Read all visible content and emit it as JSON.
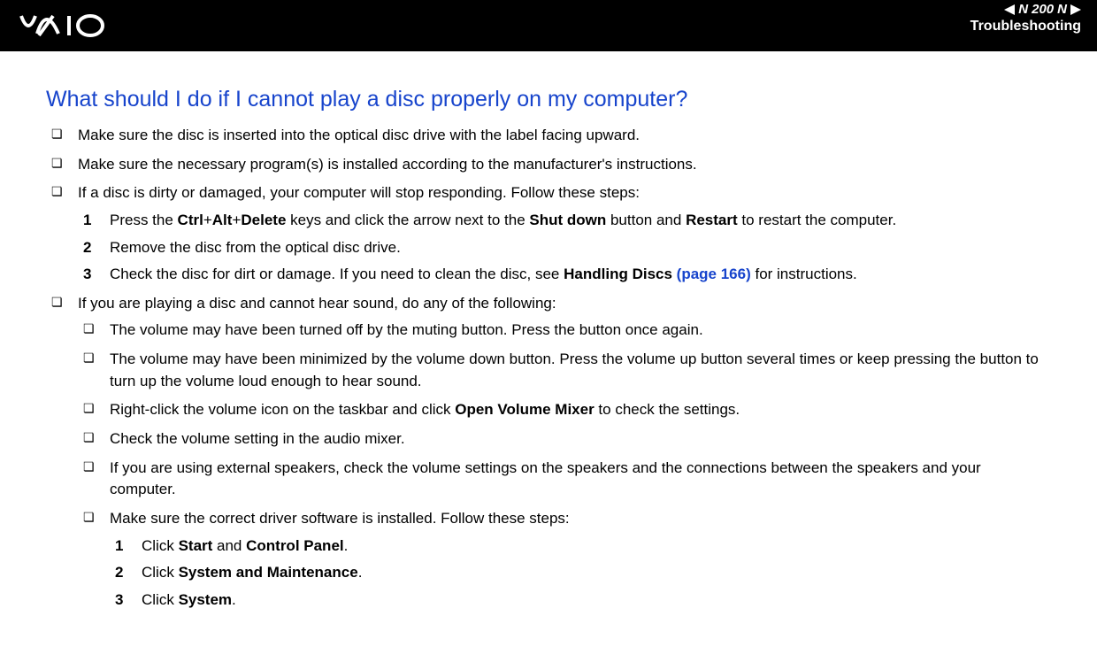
{
  "header": {
    "page_number": "200",
    "section": "Troubleshooting",
    "n_letter": "N"
  },
  "question": "What should I do if I cannot play a disc properly on my computer?",
  "bullets": {
    "b1": "Make sure the disc is inserted into the optical disc drive with the label facing upward.",
    "b2": "Make sure the necessary program(s) is installed according to the manufacturer's instructions.",
    "b3": "If a disc is dirty or damaged, your computer will stop responding. Follow these steps:",
    "b4": "If you are playing a disc and cannot hear sound, do any of the following:"
  },
  "steps1": {
    "s1_pre": "Press the ",
    "s1_ctrl": "Ctrl",
    "s1_plus1": "+",
    "s1_alt": "Alt",
    "s1_plus2": "+",
    "s1_del": "Delete",
    "s1_mid": " keys and click the arrow next to the ",
    "s1_shut": "Shut down",
    "s1_mid2": " button and ",
    "s1_restart": "Restart",
    "s1_end": " to restart the computer.",
    "s2": "Remove the disc from the optical disc drive.",
    "s3_pre": "Check the disc for dirt or damage. If you need to clean the disc, see ",
    "s3_hd": "Handling Discs ",
    "s3_page": "(page 166)",
    "s3_end": " for instructions."
  },
  "sub": {
    "s1": "The volume may have been turned off by the muting button. Press the button once again.",
    "s2": "The volume may have been minimized by the volume down button. Press the volume up button several times or keep pressing the button to turn up the volume loud enough to hear sound.",
    "s3_pre": "Right-click the volume icon on the taskbar and click ",
    "s3_b": "Open Volume Mixer",
    "s3_end": " to check the settings.",
    "s4": "Check the volume setting in the audio mixer.",
    "s5": "If you are using external speakers, check the volume settings on the speakers and the connections between the speakers and your computer.",
    "s6": "Make sure the correct driver software is installed. Follow these steps:"
  },
  "steps2": {
    "s1_pre": "Click ",
    "s1_b1": "Start",
    "s1_mid": " and ",
    "s1_b2": "Control Panel",
    "s1_end": ".",
    "s2_pre": "Click ",
    "s2_b": "System and Maintenance",
    "s2_end": ".",
    "s3_pre": "Click ",
    "s3_b": "System",
    "s3_end": "."
  }
}
